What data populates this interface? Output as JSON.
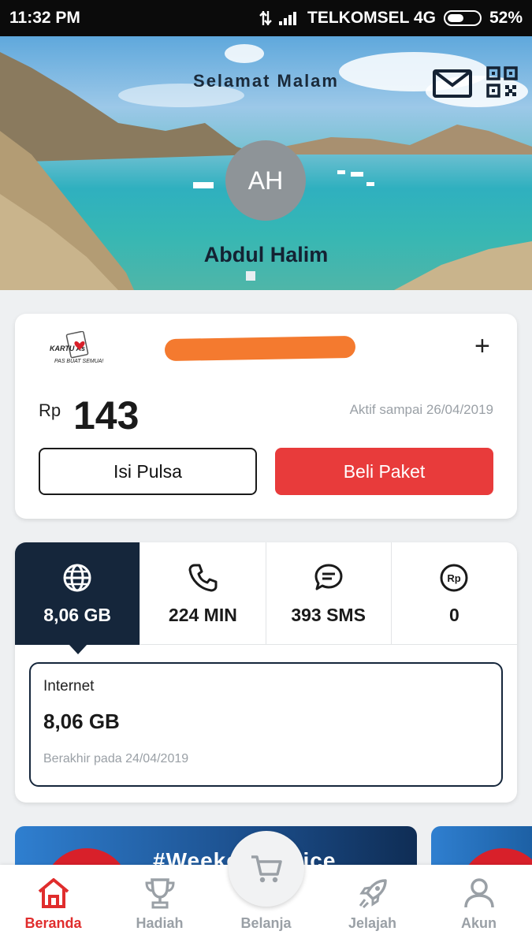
{
  "status_bar": {
    "time": "11:32 PM",
    "carrier": "TELKOMSEL 4G",
    "battery": "52%",
    "battery_level": 0.52
  },
  "header": {
    "greeting": "Selamat Malam",
    "avatar_initials": "AH",
    "user_name": "Abdul Halim",
    "icons": [
      "mail-icon",
      "qr-code-icon"
    ]
  },
  "balance_card": {
    "brand_logo": "kartu-as-logo",
    "brand_logo_text": "KARTU As",
    "brand_tagline": "PAS BUAT SEMUA!",
    "phone_number_redacted": true,
    "add_icon": "plus-icon",
    "currency": "Rp",
    "balance": "143",
    "active_until": "Aktif sampai 26/04/2019",
    "buttons": {
      "isi_pulsa": "Isi Pulsa",
      "beli_paket": "Beli Paket"
    },
    "colors": {
      "accent": "#e83b3b"
    }
  },
  "quota_card": {
    "tabs": [
      {
        "icon": "globe-icon",
        "value": "8,06 GB",
        "active": true
      },
      {
        "icon": "phone-icon",
        "value": "224 MIN",
        "active": false
      },
      {
        "icon": "sms-icon",
        "value": "393 SMS",
        "active": false
      },
      {
        "icon": "rp-coin-icon",
        "value": "0",
        "active": false
      }
    ],
    "detail": {
      "title": "Internet",
      "value": "8,06 GB",
      "expiry": "Berakhir pada 24/04/2019"
    },
    "colors": {
      "active_tab": "#15263b"
    }
  },
  "promo": {
    "banner_text": "#Weekend Voice"
  },
  "bottom_nav": {
    "items": [
      {
        "label": "Beranda",
        "icon": "home-icon",
        "active": true
      },
      {
        "label": "Hadiah",
        "icon": "trophy-icon",
        "active": false
      },
      {
        "label": "Belanja",
        "icon": "cart-icon",
        "active": false
      },
      {
        "label": "Jelajah",
        "icon": "rocket-icon",
        "active": false
      },
      {
        "label": "Akun",
        "icon": "user-icon",
        "active": false
      }
    ],
    "colors": {
      "active": "#e02d2d",
      "inactive": "#9aa0a6"
    }
  }
}
